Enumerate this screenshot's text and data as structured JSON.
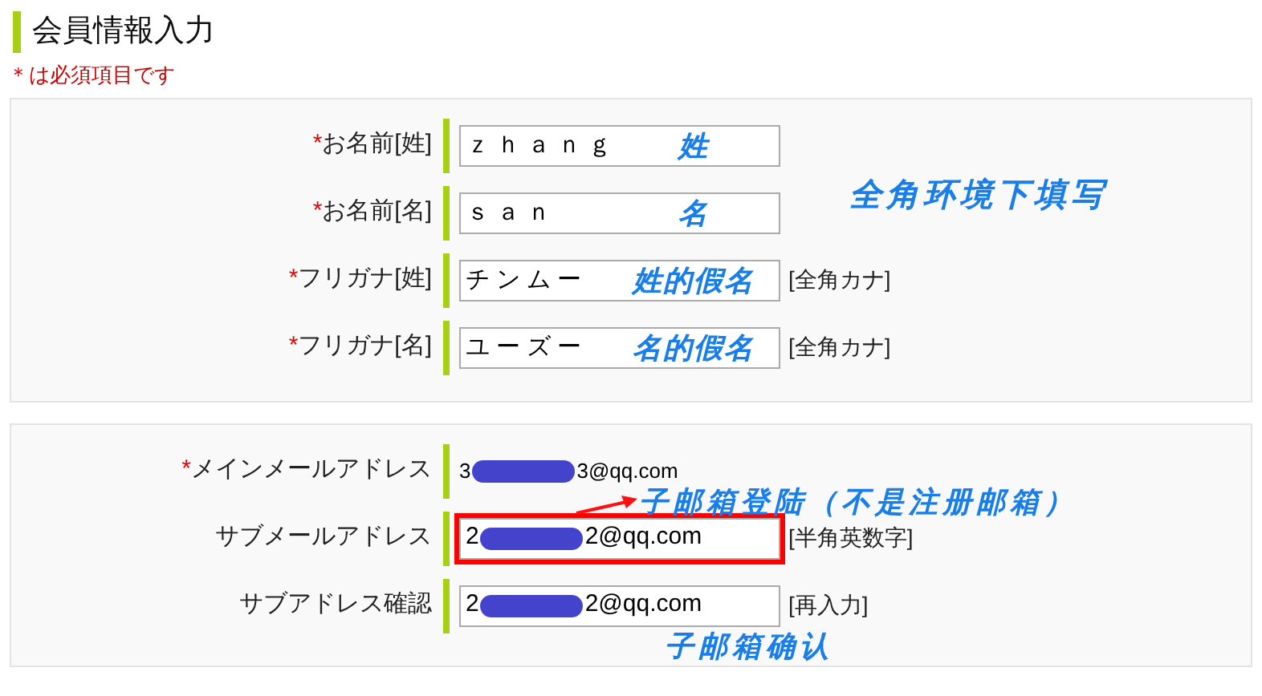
{
  "title": "会員情報入力",
  "required_note": "＊は必須項目です",
  "panels": [
    {
      "note": "全角环境下填写",
      "fields": [
        {
          "kind": "input",
          "mark": "*",
          "label": "お名前[姓]",
          "value": "ｚｈａｎｇ",
          "annotation": {
            "text": "姓",
            "kind": "inside"
          }
        },
        {
          "kind": "input",
          "mark": "*",
          "label": "お名前[名]",
          "value": "ｓａｎ",
          "annotation": {
            "text": "名",
            "kind": "inside"
          }
        },
        {
          "kind": "input",
          "mark": "*",
          "label": "フリガナ[姓]",
          "value": "チンムー",
          "hint": "[全角カナ]",
          "annotation": {
            "text": "姓的假名",
            "kind": "inside"
          }
        },
        {
          "kind": "input",
          "mark": "*",
          "label": "フリガナ[名]",
          "value": "ユーズー",
          "hint": "[全角カナ]",
          "annotation": {
            "text": "名的假名",
            "kind": "inside"
          }
        }
      ]
    },
    {
      "fields": [
        {
          "kind": "static",
          "mark": "*",
          "label": "メインメールアドレス",
          "value_start": "3",
          "value_end": "3@qq.com"
        },
        {
          "kind": "input",
          "label": "サブメールアドレス",
          "value_start": "2",
          "value_end": "2@qq.com",
          "hint": "[半角英数字]",
          "highlighted": true,
          "annotation": {
            "text": "子邮箱登陆（不是注册邮箱）",
            "kind": "above_arrow"
          }
        },
        {
          "kind": "input",
          "label": "サブアドレス確認",
          "value_start": "2",
          "value_end": "2@qq.com",
          "hint": "[再入力]",
          "highlighted": false,
          "annotation": {
            "text": "子邮箱确认",
            "kind": "below"
          }
        }
      ]
    }
  ]
}
